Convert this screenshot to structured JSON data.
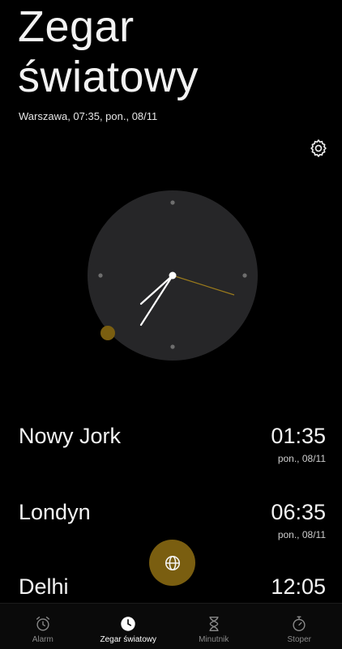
{
  "header": {
    "title_line1": "Zegar",
    "title_line2": "światowy",
    "local_info": "Warszawa, 07:35, pon., 08/11"
  },
  "icons": {
    "settings": "gear-icon",
    "fab": "globe-icon"
  },
  "colors": {
    "accent": "#7a5e10",
    "accent_line": "#9a7a1c",
    "clock_face": "#262628"
  },
  "cities": [
    {
      "name": "Nowy Jork",
      "time": "01:35",
      "date": "pon.,  08/11"
    },
    {
      "name": "Londyn",
      "time": "06:35",
      "date": "pon.,  08/11"
    },
    {
      "name": "Delhi",
      "time": "12:05",
      "date": ""
    }
  ],
  "nav": {
    "items": [
      {
        "label": "Alarm",
        "icon": "alarm-clock-icon",
        "active": false
      },
      {
        "label": "Zegar światowy",
        "icon": "clock-icon",
        "active": true
      },
      {
        "label": "Minutnik",
        "icon": "hourglass-icon",
        "active": false
      },
      {
        "label": "Stoper",
        "icon": "stopwatch-icon",
        "active": false
      }
    ]
  }
}
